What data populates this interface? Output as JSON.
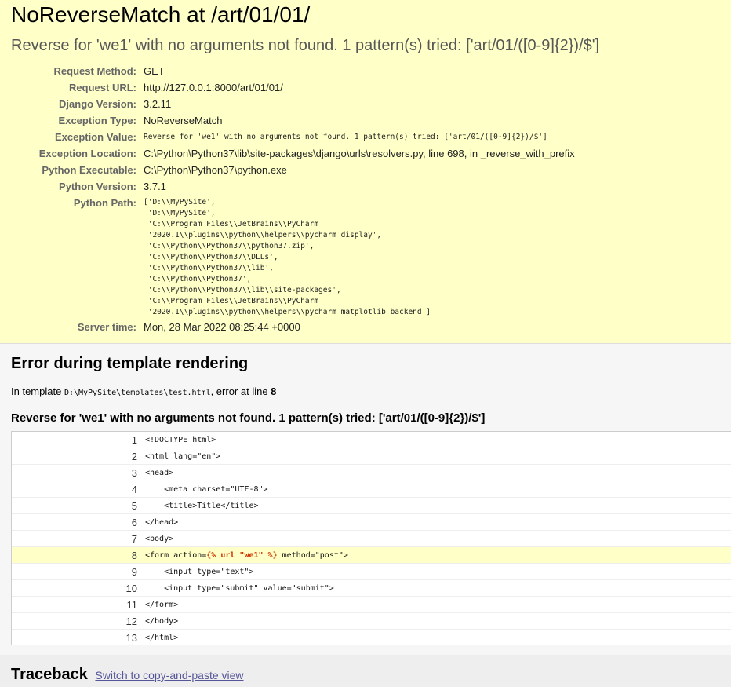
{
  "summary": {
    "title": "NoReverseMatch at /art/01/01/",
    "subtitle": "Reverse for 'we1' with no arguments not found. 1 pattern(s) tried: ['art/01/([0-9]{2})/$']",
    "rows": [
      {
        "label": "Request Method:",
        "value": "GET"
      },
      {
        "label": "Request URL:",
        "value": "http://127.0.0.1:8000/art/01/01/"
      },
      {
        "label": "Django Version:",
        "value": "3.2.11"
      },
      {
        "label": "Exception Type:",
        "value": "NoReverseMatch"
      },
      {
        "label": "Exception Value:",
        "value": "Reverse for 'we1' with no arguments not found. 1 pattern(s) tried: ['art/01/([0-9]{2})/$']"
      },
      {
        "label": "Exception Location:",
        "value": "C:\\Python\\Python37\\lib\\site-packages\\django\\urls\\resolvers.py, line 698, in _reverse_with_prefix"
      },
      {
        "label": "Python Executable:",
        "value": "C:\\Python\\Python37\\python.exe"
      },
      {
        "label": "Python Version:",
        "value": "3.7.1"
      },
      {
        "label": "Python Path:",
        "value": ""
      },
      {
        "label": "Server time:",
        "value": "Mon, 28 Mar 2022 08:25:44 +0000"
      }
    ],
    "python_path": [
      "['D:\\\\MyPySite',",
      " 'D:\\\\MyPySite',",
      " 'C:\\\\Program Files\\\\JetBrains\\\\PyCharm '",
      " '2020.1\\\\plugins\\\\python\\\\helpers\\\\pycharm_display',",
      " 'C:\\\\Python\\\\Python37\\\\python37.zip',",
      " 'C:\\\\Python\\\\Python37\\\\DLLs',",
      " 'C:\\\\Python\\\\Python37\\\\lib',",
      " 'C:\\\\Python\\\\Python37',",
      " 'C:\\\\Python\\\\Python37\\\\lib\\\\site-packages',",
      " 'C:\\\\Program Files\\\\JetBrains\\\\PyCharm '",
      " '2020.1\\\\plugins\\\\python\\\\helpers\\\\pycharm_matplotlib_backend']"
    ]
  },
  "template": {
    "heading": "Error during template rendering",
    "info_prefix": "In template ",
    "info_path": "D:\\MyPySite\\templates\\test.html",
    "info_middle": ", error at line ",
    "info_line": "8",
    "error_message": "Reverse for 'we1' with no arguments not found. 1 pattern(s) tried: ['art/01/([0-9]{2})/$']",
    "lines": [
      {
        "num": "1",
        "code": "<!DOCTYPE html>"
      },
      {
        "num": "2",
        "code": "<html lang=\"en\">"
      },
      {
        "num": "3",
        "code": "<head>"
      },
      {
        "num": "4",
        "code": "    <meta charset=\"UTF-8\">"
      },
      {
        "num": "5",
        "code": "    <title>Title</title>"
      },
      {
        "num": "6",
        "code": "</head>"
      },
      {
        "num": "7",
        "code": "<body>"
      },
      {
        "num": "8",
        "code_before": "<form action=",
        "code_tag": "{% url \"we1\" %}",
        "code_after": " method=\"post\">"
      },
      {
        "num": "9",
        "code": "    <input type=\"text\">"
      },
      {
        "num": "10",
        "code": "    <input type=\"submit\" value=\"submit\">"
      },
      {
        "num": "11",
        "code": "</form>"
      },
      {
        "num": "12",
        "code": "</body>"
      },
      {
        "num": "13",
        "code": "</html>"
      }
    ]
  },
  "traceback": {
    "heading": "Traceback",
    "switch_link": "Switch to copy-and-paste view"
  },
  "colors": {
    "summary_bg": "#ffffc8",
    "error_line_bg": "#ffffc8",
    "template_tag": "#cc3300",
    "link": "#555599"
  }
}
